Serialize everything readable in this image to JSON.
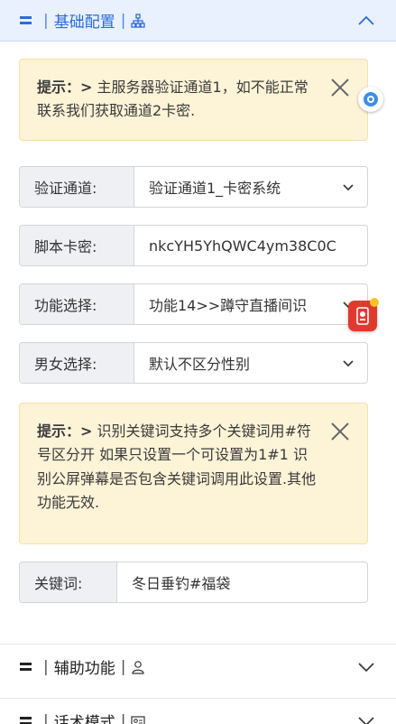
{
  "sections": {
    "basic": {
      "title": "基础配置",
      "expanded": true
    },
    "assist": {
      "title": "辅助功能"
    },
    "speech": {
      "title": "话术模式"
    }
  },
  "notice1": {
    "lead": "提示：>",
    "text": " 主服务器验证通道1，如不能正常联系我们获取通道2卡密."
  },
  "notice2": {
    "lead": "提示：>",
    "text": " 识别关键词支持多个关键词用#符号区分开 如果只设置一个可设置为1#1 识别公屏弹幕是否包含关键词调用此设置.其他功能无效."
  },
  "fields": {
    "channel": {
      "label": "验证通道:",
      "value": "验证通道1_卡密系统"
    },
    "card": {
      "label": "脚本卡密:",
      "value": "nkcYH5YhQWC4ym38C0C"
    },
    "function": {
      "label": "功能选择:",
      "value": "功能14>>蹲守直播间识"
    },
    "gender": {
      "label": "男女选择:",
      "value": "默认不区分性别"
    },
    "keyword": {
      "label": "关键词:",
      "value": "冬日垂钓#福袋"
    }
  },
  "colors": {
    "accent": "#2d6bdc",
    "notice_bg": "#fdf3d7",
    "header_bg": "#e8f1fd"
  }
}
